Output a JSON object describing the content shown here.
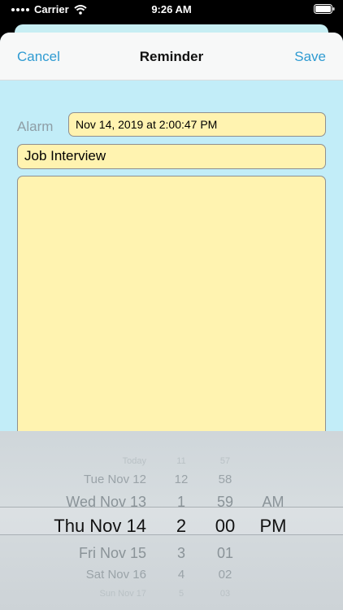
{
  "status_bar": {
    "carrier": "Carrier",
    "time": "9:26 AM"
  },
  "nav": {
    "cancel": "Cancel",
    "title": "Reminder",
    "save": "Save"
  },
  "form": {
    "alarm_label": "Alarm",
    "alarm_value": "Nov 14, 2019 at 2:00:47 PM",
    "title_value": "Job Interview",
    "notes_value": ""
  },
  "picker": {
    "rows": [
      {
        "date": "Today",
        "hour": "11",
        "minute": "57",
        "ampm": ""
      },
      {
        "date": "Tue Nov 12",
        "hour": "12",
        "minute": "58",
        "ampm": ""
      },
      {
        "date": "Wed Nov 13",
        "hour": "1",
        "minute": "59",
        "ampm": "AM"
      },
      {
        "date": "Thu Nov 14",
        "hour": "2",
        "minute": "00",
        "ampm": "PM"
      },
      {
        "date": "Fri Nov 15",
        "hour": "3",
        "minute": "01",
        "ampm": ""
      },
      {
        "date": "Sat Nov 16",
        "hour": "4",
        "minute": "02",
        "ampm": ""
      },
      {
        "date": "Sun Nov 17",
        "hour": "5",
        "minute": "03",
        "ampm": ""
      }
    ]
  }
}
